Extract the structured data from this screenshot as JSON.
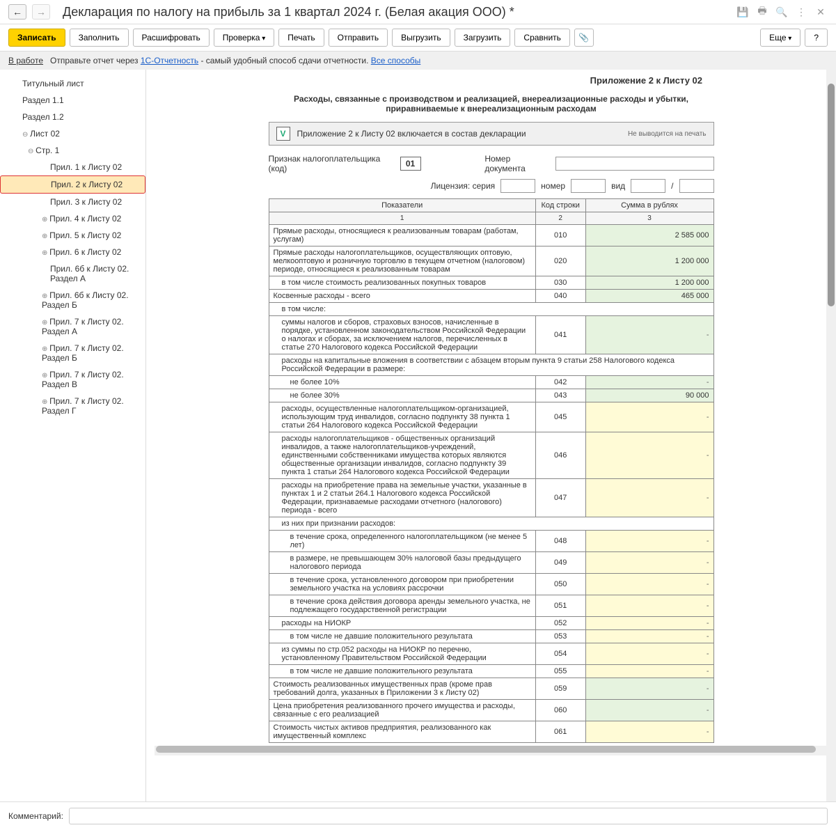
{
  "header": {
    "title": "Декларация по налогу на прибыль за 1 квартал 2024 г. (Белая акация ООО) *"
  },
  "toolbar": {
    "save": "Записать",
    "fill": "Заполнить",
    "decode": "Расшифровать",
    "check": "Проверка",
    "print": "Печать",
    "send": "Отправить",
    "upload": "Выгрузить",
    "download": "Загрузить",
    "compare": "Сравнить",
    "more": "Еще",
    "help": "?"
  },
  "infobar": {
    "status": "В работе",
    "text": "Отправьте отчет через ",
    "link1": "1С-Отчетность",
    "text2": " - самый удобный способ сдачи отчетности. ",
    "link2": "Все способы"
  },
  "tree": {
    "t0": "Титульный лист",
    "t1": "Раздел 1.1",
    "t2": "Раздел 1.2",
    "t3": "Лист 02",
    "t4": "Стр. 1",
    "t5": "Прил. 1 к Листу 02",
    "t6": "Прил. 2 к Листу 02",
    "t7": "Прил. 3 к Листу 02",
    "t8": "Прил. 4 к Листу 02",
    "t9": "Прил. 5 к Листу 02",
    "t10": "Прил. 6 к Листу 02",
    "t11": "Прил. 6б к Листу 02. Раздел А",
    "t12": "Прил. 6б к Листу 02. Раздел Б",
    "t13": "Прил. 7 к Листу 02. Раздел А",
    "t14": "Прил. 7 к Листу 02. Раздел Б",
    "t15": "Прил. 7 к Листу 02. Раздел В",
    "t16": "Прил. 7 к Листу 02. Раздел Г"
  },
  "doc": {
    "title_right": "Приложение 2 к Листу 02",
    "title_center": "Расходы, связанные с производством и реализацией, внереализационные расходы и убытки, приравниваемые к внереализационным расходам",
    "include_check": "V",
    "include_text": "Приложение 2 к Листу 02 включается в состав декларации",
    "include_note": "Не выводится на печать",
    "taxpayer_label": "Признак налогоплательщика (код)",
    "taxpayer_code": "01",
    "docnum_label": "Номер документа",
    "license_label": "Лицензия:  серия",
    "license_num": "номер",
    "license_type": "вид",
    "slash": "/",
    "th_indicator": "Показатели",
    "th_code": "Код строки",
    "th_sum": "Сумма в рублях",
    "th_n1": "1",
    "th_n2": "2",
    "th_n3": "3"
  },
  "rows": [
    {
      "ind": "Прямые расходы, относящиеся к реализованным товарам (работам, услугам)",
      "code": "010",
      "sum": "2 585 000",
      "cls": "cell-green"
    },
    {
      "ind": "Прямые расходы налогоплательщиков, осуществляющих оптовую, мелкооптовую и розничную торговлю в текущем отчетном (налоговом) периоде, относящиеся к реализованным товарам",
      "code": "020",
      "sum": "1 200 000",
      "cls": "cell-green"
    },
    {
      "ind": "в том числе стоимость реализованных покупных товаров",
      "code": "030",
      "sum": "1 200 000",
      "cls": "cell-green",
      "indent": 1
    },
    {
      "ind": "Косвенные расходы - всего",
      "code": "040",
      "sum": "465 000",
      "cls": "cell-green"
    },
    {
      "ind": "в том числе:",
      "code": "",
      "sum": "",
      "cls": "",
      "indent": 1,
      "nosum": true
    },
    {
      "ind": "суммы налогов и сборов, страховых взносов, начисленные в порядке, установленном законодательством Российской Федерации о налогах и сборах, за исключением налогов, перечисленных в статье 270 Налогового кодекса Российской Федерации",
      "code": "041",
      "sum": "-",
      "cls": "cell-green",
      "indent": 1
    },
    {
      "ind": "расходы на капитальные вложения в соответствии с абзацем вторым пункта 9 статьи 258 Налогового кодекса Российской Федерации в размере:",
      "code": "",
      "sum": "",
      "cls": "",
      "indent": 1,
      "nosum": true
    },
    {
      "ind": "не более 10%",
      "code": "042",
      "sum": "-",
      "cls": "cell-green",
      "indent": 2
    },
    {
      "ind": "не более 30%",
      "code": "043",
      "sum": "90 000",
      "cls": "cell-green",
      "indent": 2
    },
    {
      "ind": "расходы, осуществленные налогоплательщиком-организацией, использующим труд инвалидов, согласно подпункту 38 пункта 1 статьи 264 Налогового кодекса Российской Федерации",
      "code": "045",
      "sum": "-",
      "cls": "cell-yellow",
      "indent": 1
    },
    {
      "ind": "расходы налогоплательщиков - общественных организаций инвалидов, а также налогоплательщиков-учреждений, единственными собственниками имущества которых являются общественные организации инвалидов, согласно подпункту 39 пункта 1 статьи 264 Налогового кодекса Российской Федерации",
      "code": "046",
      "sum": "-",
      "cls": "cell-yellow",
      "indent": 1
    },
    {
      "ind": "расходы на приобретение права на земельные участки, указанные в пунктах 1 и 2 статьи 264.1 Налогового кодекса Российской Федерации, признаваемые расходами отчетного (налогового) периода - всего",
      "code": "047",
      "sum": "-",
      "cls": "cell-yellow",
      "indent": 1
    },
    {
      "ind": "из них при признании расходов:",
      "code": "",
      "sum": "",
      "cls": "",
      "indent": 1,
      "nosum": true
    },
    {
      "ind": "в течение срока, определенного налогоплательщиком (не менее 5 лет)",
      "code": "048",
      "sum": "-",
      "cls": "cell-yellow",
      "indent": 2
    },
    {
      "ind": "в размере, не превышающем 30% налоговой базы предыдущего налогового периода",
      "code": "049",
      "sum": "-",
      "cls": "cell-yellow",
      "indent": 2
    },
    {
      "ind": "в течение срока, установленного договором при приобретении земельного участка на условиях рассрочки",
      "code": "050",
      "sum": "-",
      "cls": "cell-yellow",
      "indent": 2
    },
    {
      "ind": "в течение срока действия договора аренды земельного участка, не подлежащего государственной регистрации",
      "code": "051",
      "sum": "-",
      "cls": "cell-yellow",
      "indent": 2
    },
    {
      "ind": "расходы на НИОКР",
      "code": "052",
      "sum": "-",
      "cls": "cell-yellow",
      "indent": 1
    },
    {
      "ind": "в том числе не давшие положительного результата",
      "code": "053",
      "sum": "-",
      "cls": "cell-yellow",
      "indent": 2
    },
    {
      "ind": "из суммы по стр.052 расходы на НИОКР по перечню, установленному Правительством Российской Федерации",
      "code": "054",
      "sum": "-",
      "cls": "cell-yellow",
      "indent": 1
    },
    {
      "ind": "в том числе не давшие положительного результата",
      "code": "055",
      "sum": "-",
      "cls": "cell-yellow",
      "indent": 2
    },
    {
      "ind": "Стоимость реализованных имущественных прав (кроме прав требований долга, указанных в Приложении 3 к Листу 02)",
      "code": "059",
      "sum": "-",
      "cls": "cell-green"
    },
    {
      "ind": "Цена приобретения реализованного прочего имущества и расходы, связанные с его реализацией",
      "code": "060",
      "sum": "-",
      "cls": "cell-green"
    },
    {
      "ind": "Стоимость чистых активов предприятия, реализованного как имущественный комплекс",
      "code": "061",
      "sum": "-",
      "cls": "cell-yellow"
    }
  ],
  "footer": {
    "comment_label": "Комментарий:"
  }
}
